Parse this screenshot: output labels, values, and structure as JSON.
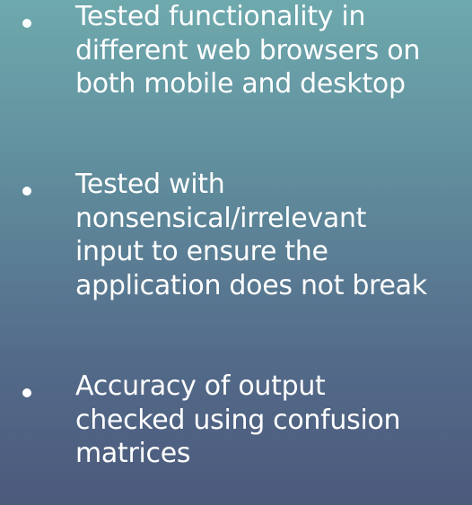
{
  "bullets": [
    {
      "text": "Tested functionality in\ndifferent web browsers on\nboth mobile and desktop"
    },
    {
      "text": "Tested with\nnonsensical/irrelevant\ninput to ensure the\napplication does not break"
    },
    {
      "text": "Accuracy of output\nchecked using confusion\nmatrices"
    }
  ],
  "colors": {
    "text": "#ffffff",
    "background_top": "#6ea9ad",
    "background_bottom": "#4c5a7c"
  }
}
